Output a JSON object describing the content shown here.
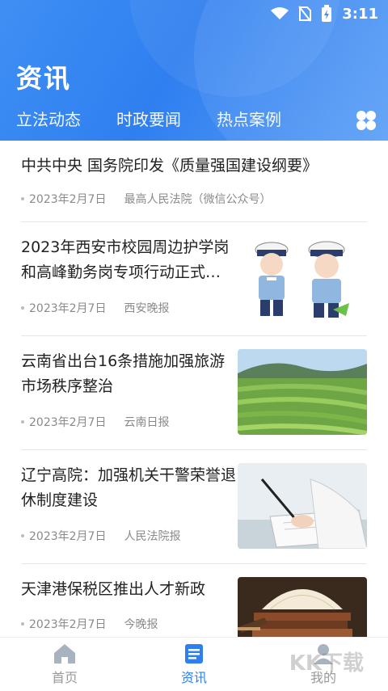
{
  "status_bar": {
    "time": "3:11"
  },
  "header": {
    "title": "资讯",
    "tabs": [
      {
        "label": "立法动态",
        "active": true
      },
      {
        "label": "时政要闻",
        "active": false
      },
      {
        "label": "热点案例",
        "active": false
      }
    ],
    "more_icon": "grid-icon"
  },
  "news": [
    {
      "title": "中共中央 国务院印发《质量强国建设纲要》",
      "date": "2023年2月7日",
      "source": "最高人民法院（微信公众号）",
      "image": null
    },
    {
      "title": "2023年西安市校园周边护学岗和高峰勤务岗专项行动正式…",
      "date": "2023年2月7日",
      "source": "西安晚报",
      "image": "traffic-police"
    },
    {
      "title": "云南省出台16条措施加强旅游市场秩序整治",
      "date": "2023年2月7日",
      "source": "云南日报",
      "image": "terraced-fields"
    },
    {
      "title": "辽宁高院：加强机关干警荣誉退休制度建设",
      "date": "2023年2月7日",
      "source": "人民法院报",
      "image": "signing-document"
    },
    {
      "title": "天津港保税区推出人才新政",
      "date": "2023年2月7日",
      "source": "今晚报",
      "image": "books-gavel"
    }
  ],
  "bottom_nav": [
    {
      "label": "首页",
      "icon": "home-icon",
      "active": false
    },
    {
      "label": "资讯",
      "icon": "news-icon",
      "active": true
    },
    {
      "label": "我的",
      "icon": "profile-icon",
      "active": false
    }
  ],
  "watermark": "KK下载",
  "colors": {
    "primary": "#2f7ff0",
    "meta": "#8a8a8a"
  }
}
